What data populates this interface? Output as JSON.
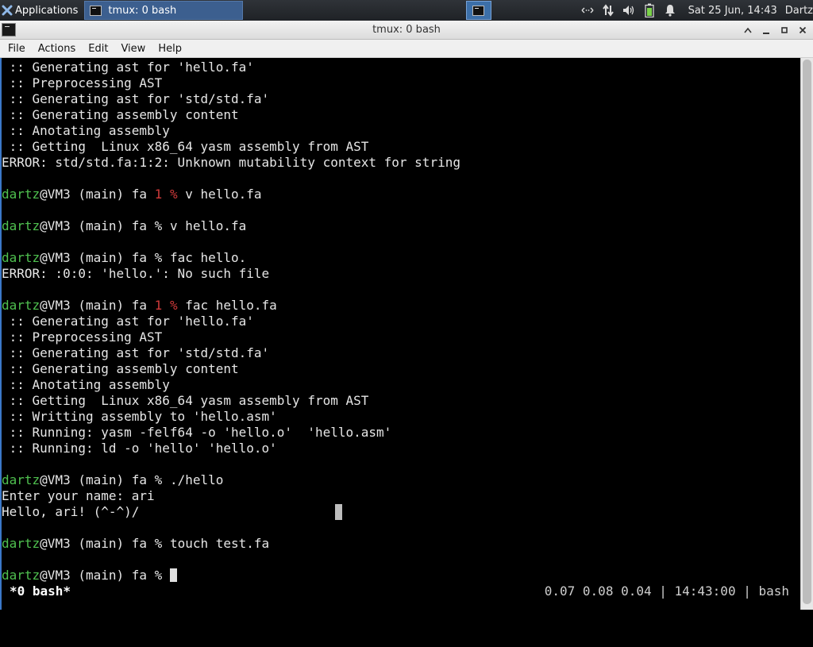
{
  "panel": {
    "applications_label": "Applications",
    "task_label": "tmux: 0 bash",
    "clock": "Sat 25 Jun, 14:43",
    "user": "Dartz",
    "tray_icons": [
      "network-arrows-icon",
      "transfer-icon",
      "volume-icon",
      "battery-icon",
      "bell-icon"
    ]
  },
  "window": {
    "title": "tmux: 0 bash",
    "controls": [
      "shade-up-icon",
      "minimize-icon",
      "maximize-icon",
      "close-icon"
    ]
  },
  "menu": [
    "File",
    "Actions",
    "Edit",
    "View",
    "Help"
  ],
  "terminal": {
    "lines": [
      {
        "t": " :: Generating ast for 'hello.fa'"
      },
      {
        "t": " :: Preprocessing AST"
      },
      {
        "t": " :: Generating ast for 'std/std.fa'"
      },
      {
        "t": " :: Generating assembly content"
      },
      {
        "t": " :: Anotating assembly"
      },
      {
        "t": " :: Getting  Linux x86_64 yasm assembly from AST"
      },
      {
        "t": "ERROR: std/std.fa:1:2: Unknown mutability context for string"
      },
      {
        "t": ""
      },
      {
        "user": "dartz",
        "rest": "@VM3 (main) fa ",
        "code": "1 ",
        "prompt": "% ",
        "cmd": "v hello.fa"
      },
      {
        "t": ""
      },
      {
        "user": "dartz",
        "rest": "@VM3 (main) fa ",
        "code": "",
        "prompt": "% ",
        "cmd": "v hello.fa"
      },
      {
        "t": ""
      },
      {
        "user": "dartz",
        "rest": "@VM3 (main) fa ",
        "code": "",
        "prompt": "% ",
        "cmd": "fac hello."
      },
      {
        "t": "ERROR: :0:0: 'hello.': No such file"
      },
      {
        "t": ""
      },
      {
        "user": "dartz",
        "rest": "@VM3 (main) fa ",
        "code": "1 ",
        "prompt": "% ",
        "cmd": "fac hello.fa"
      },
      {
        "t": " :: Generating ast for 'hello.fa'"
      },
      {
        "t": " :: Preprocessing AST"
      },
      {
        "t": " :: Generating ast for 'std/std.fa'"
      },
      {
        "t": " :: Generating assembly content"
      },
      {
        "t": " :: Anotating assembly"
      },
      {
        "t": " :: Getting  Linux x86_64 yasm assembly from AST"
      },
      {
        "t": " :: Writting assembly to 'hello.asm'"
      },
      {
        "t": " :: Running: yasm -felf64 -o 'hello.o'  'hello.asm'"
      },
      {
        "t": " :: Running: ld -o 'hello' 'hello.o'"
      },
      {
        "t": ""
      },
      {
        "user": "dartz",
        "rest": "@VM3 (main) fa ",
        "code": "",
        "prompt": "% ",
        "cmd": "./hello"
      },
      {
        "t": "Enter your name: ari"
      },
      {
        "t": "Hello, ari! (^-^)/"
      },
      {
        "t": ""
      },
      {
        "user": "dartz",
        "rest": "@VM3 (main) fa ",
        "code": "",
        "prompt": "% ",
        "cmd": "touch test.fa"
      },
      {
        "t": ""
      },
      {
        "user": "dartz",
        "rest": "@VM3 (main) fa ",
        "code": "",
        "prompt": "% ",
        "cmd": "",
        "cursor": true
      }
    ],
    "status_left": "*0 bash*",
    "status_right": "0.07 0.08 0.04 | 14:43:00 | bash"
  },
  "colors": {
    "prompt_user": "#4fc04f",
    "exit_code": "#d03a3a",
    "panel_bg": "#1f2226",
    "active_task": "#3c5f8f",
    "terminal_bg": "#000000"
  }
}
